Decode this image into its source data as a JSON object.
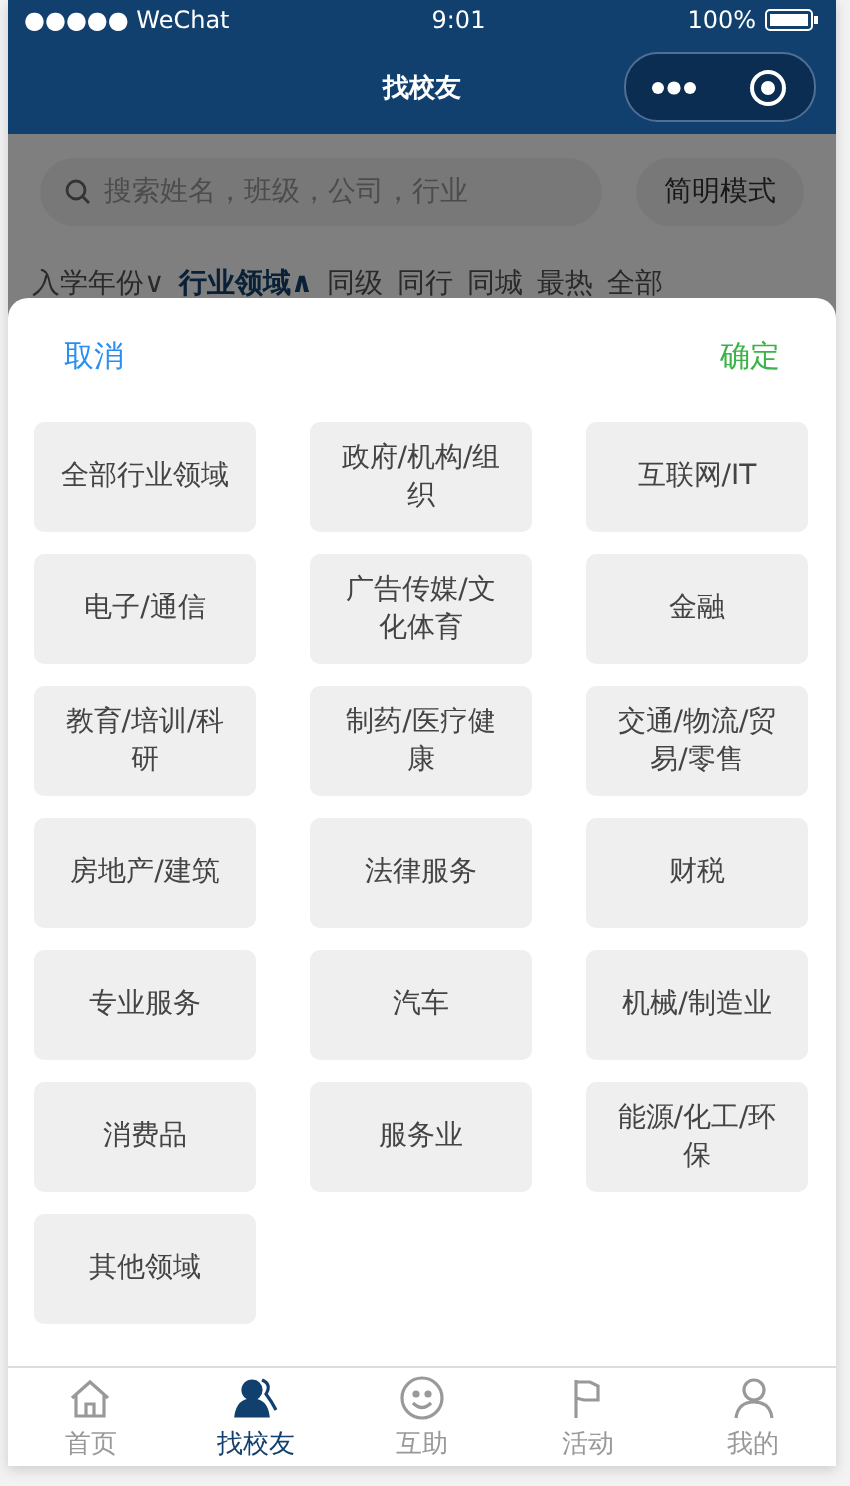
{
  "status_bar": {
    "carrier": "●●●●● WeChat",
    "time": "9:01",
    "battery": "100%"
  },
  "nav": {
    "title": "找校友"
  },
  "search": {
    "placeholder": "搜索姓名，班级，公司，行业",
    "mode_button": "简明模式"
  },
  "filters": [
    {
      "label": "入学年份",
      "arrow": "∨",
      "selected": false
    },
    {
      "label": "行业领域",
      "arrow": "∧",
      "selected": true
    },
    {
      "label": "同级",
      "selected": false
    },
    {
      "label": "同行",
      "selected": false
    },
    {
      "label": "同城",
      "selected": false
    },
    {
      "label": "最热",
      "selected": false
    },
    {
      "label": "全部",
      "selected": false
    }
  ],
  "sheet": {
    "cancel": "取消",
    "confirm": "确定",
    "options": [
      "全部行业领域",
      "政府/机构/组织",
      "互联网/IT",
      "电子/通信",
      "广告传媒/文化体育",
      "金融",
      "教育/培训/科研",
      "制药/医疗健康",
      "交通/物流/贸易/零售",
      "房地产/建筑",
      "法律服务",
      "财税",
      "专业服务",
      "汽车",
      "机械/制造业",
      "消费品",
      "服务业",
      "能源/化工/环保",
      "其他领域"
    ]
  },
  "tab_bar": [
    {
      "label": "首页",
      "selected": false
    },
    {
      "label": "找校友",
      "selected": true
    },
    {
      "label": "互助",
      "selected": false
    },
    {
      "label": "活动",
      "selected": false
    },
    {
      "label": "我的",
      "selected": false
    }
  ]
}
